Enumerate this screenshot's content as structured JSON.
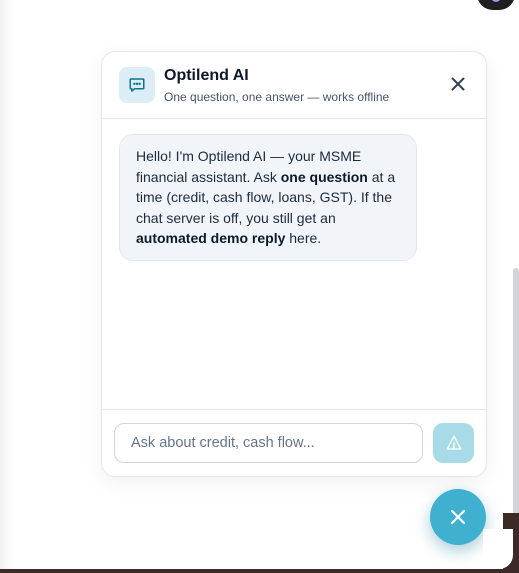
{
  "chat": {
    "title": "Optilend AI",
    "subtitle": "One question, one answer — works offline",
    "messages": [
      {
        "role": "assistant",
        "segments": [
          {
            "text": "Hello! I'm Optilend AI — your MSME financial assistant. Ask ",
            "bold": false
          },
          {
            "text": "one question",
            "bold": true
          },
          {
            "text": " at a time (credit, cash flow, loans, GST). If the chat server is off, you still get an ",
            "bold": false
          },
          {
            "text": "automated demo reply",
            "bold": true
          },
          {
            "text": " here.",
            "bold": false
          }
        ]
      }
    ],
    "input_placeholder": "Ask about credit, cash flow...",
    "input_value": ""
  },
  "icons": {
    "bot_badge": "chat-bubble-icon",
    "close": "close-icon",
    "send": "send-icon",
    "fab": "close-icon"
  },
  "colors": {
    "accent": "#3fb0d0",
    "send_button": "#a8dbe8",
    "badge_bg": "#dbeef5",
    "bubble_bg": "#f1f5f9"
  }
}
